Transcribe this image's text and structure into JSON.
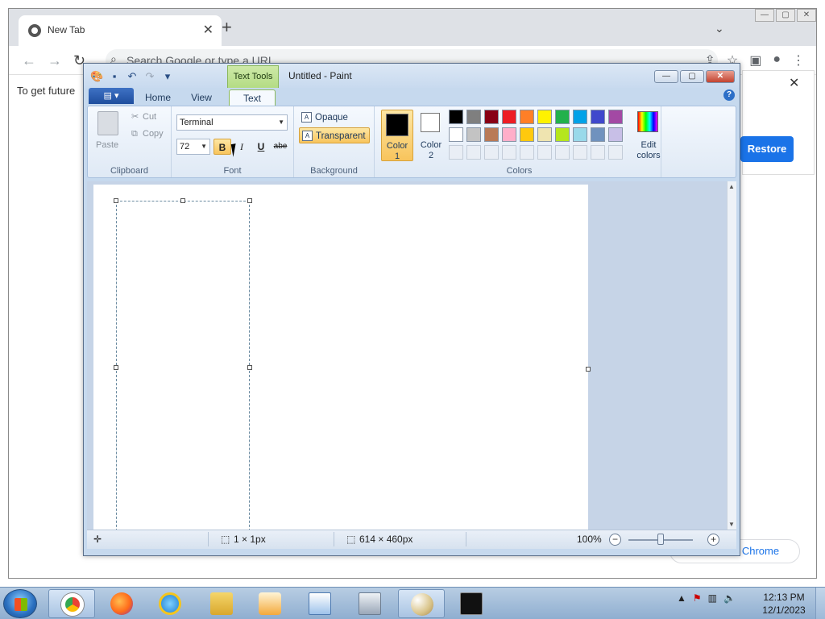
{
  "chrome": {
    "tab_title": "New Tab",
    "omnibox_placeholder": "Search Google or type a URL",
    "infobar_text": "To get future",
    "restore_label": "Restore",
    "customize_label": "e Chrome"
  },
  "paint": {
    "window_title": "Untitled - Paint",
    "contextual_tab_label": "Text Tools",
    "tabs": [
      {
        "label": "Home"
      },
      {
        "label": "View"
      },
      {
        "label": "Text"
      }
    ],
    "clipboard": {
      "paste_label": "Paste",
      "cut_label": "Cut",
      "copy_label": "Copy",
      "group_label": "Clipboard"
    },
    "font": {
      "family": "Terminal",
      "size": "72",
      "bold": "B",
      "italic": "I",
      "underline": "U",
      "strikethrough": "abe",
      "group_label": "Font"
    },
    "background": {
      "opaque_label": "Opaque",
      "transparent_label": "Transparent",
      "group_label": "Background"
    },
    "colors": {
      "color1_label_1": "Color",
      "color1_label_2": "1",
      "color2_label_1": "Color",
      "color2_label_2": "2",
      "edit_label_1": "Edit",
      "edit_label_2": "colors",
      "group_label": "Colors",
      "color1": "#000000",
      "color2": "#ffffff",
      "palette": [
        "#000000",
        "#7f7f7f",
        "#880015",
        "#ed1c24",
        "#ff7f27",
        "#fff200",
        "#22b14c",
        "#00a2e8",
        "#3f48cc",
        "#a349a4",
        "#ffffff",
        "#c3c3c3",
        "#b97a57",
        "#ffaec9",
        "#ffc90e",
        "#efe4b0",
        "#b5e61d",
        "#99d9ea",
        "#7092be",
        "#c8bfe7"
      ]
    },
    "status": {
      "selection_size": "1 × 1px",
      "canvas_size": "614 × 460px",
      "zoom": "100%"
    }
  },
  "taskbar": {
    "time": "12:13 PM",
    "date": "12/1/2023"
  }
}
